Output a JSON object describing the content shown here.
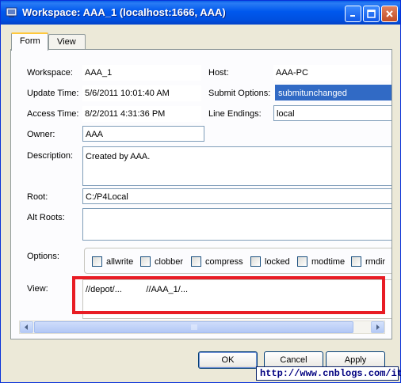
{
  "window": {
    "title": "Workspace: AAA_1 (localhost:1666, AAA)",
    "title_buttons": [
      "minimize-icon",
      "maximize-icon",
      "close-icon"
    ]
  },
  "tabs": [
    {
      "label": "Form",
      "active": true
    },
    {
      "label": "View",
      "active": false
    }
  ],
  "form": {
    "workspace_label": "Workspace:",
    "workspace_value": "AAA_1",
    "host_label": "Host:",
    "host_value": "AAA-PC",
    "update_time_label": "Update Time:",
    "update_time_value": "5/6/2011 10:01:40 AM",
    "submit_options_label": "Submit Options:",
    "submit_options_value": "submitunchanged",
    "access_time_label": "Access Time:",
    "access_time_value": "8/2/2011 4:31:36 PM",
    "line_endings_label": "Line Endings:",
    "line_endings_value": "local",
    "owner_label": "Owner:",
    "owner_value": "AAA",
    "description_label": "Description:",
    "description_value": "Created by AAA.",
    "root_label": "Root:",
    "root_value": "C:/P4Local",
    "alt_roots_label": "Alt Roots:",
    "alt_roots_value": "",
    "options_label": "Options:",
    "options": [
      "allwrite",
      "clobber",
      "compress",
      "locked",
      "modtime",
      "rmdir"
    ],
    "view_label": "View:",
    "view_value": "//depot/...          //AAA_1/..."
  },
  "buttons": {
    "ok": "OK",
    "cancel": "Cancel",
    "apply": "Apply"
  },
  "watermark": "http://www.cnblogs.com/itech",
  "colors": {
    "titlebar": "#0058ee",
    "selection": "#316ac5",
    "highlight_frame": "#e81c24"
  }
}
